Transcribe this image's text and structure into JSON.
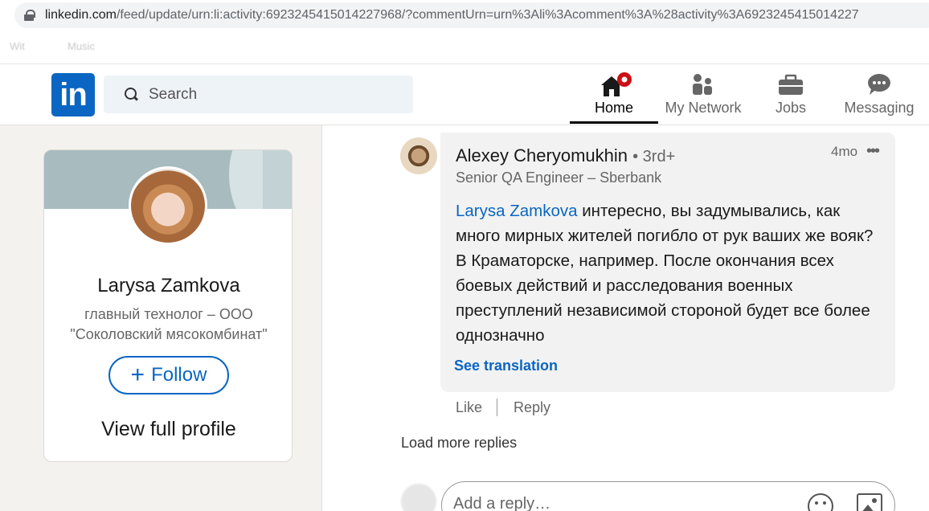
{
  "browser": {
    "url_host": "linkedin.com",
    "url_path": "/feed/update/urn:li:activity:6923245415014227968/?commentUrn=urn%3Ali%3Acomment%3A%28activity%3A6923245415014227",
    "bookmarks": [
      "Wit",
      "Music"
    ]
  },
  "nav": {
    "search_placeholder": "Search",
    "items": [
      {
        "label": "Home",
        "icon": "home-icon",
        "active": true
      },
      {
        "label": "My Network",
        "icon": "network-icon"
      },
      {
        "label": "Jobs",
        "icon": "briefcase-icon"
      },
      {
        "label": "Messaging",
        "icon": "messaging-icon"
      }
    ],
    "brand_color": "#0a66c2"
  },
  "profile_card": {
    "name": "Larysa Zamkova",
    "headline": "главный технолог – ООО \"Соколовский мясокомбинат\"",
    "follow_label": "Follow",
    "follow_plus": "+",
    "view_profile_label": "View full profile"
  },
  "comment": {
    "author": "Alexey Cheryomukhin",
    "degree": "• 3rd+",
    "headline": "Senior QA Engineer – Sberbank",
    "time": "4mo",
    "more": "•••",
    "mention": "Larysa Zamkova",
    "text": " интересно, вы задумывались, как много мирных жителей погибло от рук ваших же вояк? В Краматорске, например. После окончания всех боевых действий и расследования военных преступлений независимой стороной будет все более однозначно",
    "see_translation": "See translation",
    "like": "Like",
    "reply": "Reply"
  },
  "thread": {
    "load_more": "Load more replies",
    "reply_placeholder": "Add a reply…"
  }
}
